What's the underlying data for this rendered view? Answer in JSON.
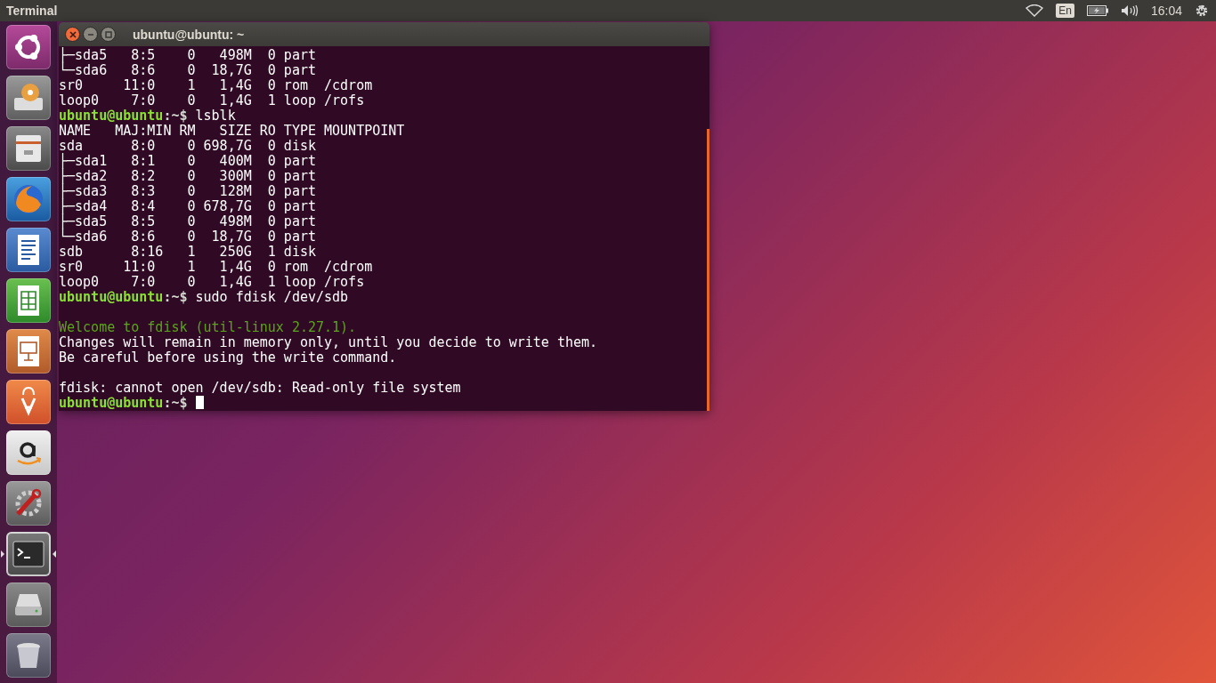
{
  "top_bar": {
    "title": "Terminal",
    "keyboard_layout": "En",
    "clock": "16:04"
  },
  "launcher": [
    {
      "kind": "dash",
      "selected": false
    },
    {
      "kind": "installer",
      "selected": false
    },
    {
      "kind": "files",
      "selected": false
    },
    {
      "kind": "browser",
      "selected": false
    },
    {
      "kind": "writer",
      "selected": false
    },
    {
      "kind": "calc",
      "selected": false
    },
    {
      "kind": "impress",
      "selected": false
    },
    {
      "kind": "store",
      "selected": false
    },
    {
      "kind": "amazon",
      "selected": false
    },
    {
      "kind": "settings",
      "selected": false
    },
    {
      "kind": "terminal",
      "selected": true
    },
    {
      "kind": "drive",
      "selected": false
    },
    {
      "kind": "trash",
      "selected": false
    }
  ],
  "window": {
    "title": "ubuntu@ubuntu: ~",
    "lines": [
      {
        "kind": "output",
        "text": "├─sda5   8:5    0   498M  0 part"
      },
      {
        "kind": "output",
        "text": "└─sda6   8:6    0  18,7G  0 part"
      },
      {
        "kind": "output",
        "text": "sr0     11:0    1   1,4G  0 rom  /cdrom"
      },
      {
        "kind": "output",
        "text": "loop0    7:0    0   1,4G  1 loop /rofs"
      },
      {
        "kind": "prompt",
        "user": "ubuntu@ubuntu",
        "path": ":~$",
        "command": "lsblk",
        "cursor": false
      },
      {
        "kind": "output",
        "text": "NAME   MAJ:MIN RM   SIZE RO TYPE MOUNTPOINT"
      },
      {
        "kind": "output",
        "text": "sda      8:0    0 698,7G  0 disk"
      },
      {
        "kind": "output",
        "text": "├─sda1   8:1    0   400M  0 part"
      },
      {
        "kind": "output",
        "text": "├─sda2   8:2    0   300M  0 part"
      },
      {
        "kind": "output",
        "text": "├─sda3   8:3    0   128M  0 part"
      },
      {
        "kind": "output",
        "text": "├─sda4   8:4    0 678,7G  0 part"
      },
      {
        "kind": "output",
        "text": "├─sda5   8:5    0   498M  0 part"
      },
      {
        "kind": "output",
        "text": "└─sda6   8:6    0  18,7G  0 part"
      },
      {
        "kind": "output",
        "text": "sdb      8:16   1   250G  1 disk"
      },
      {
        "kind": "output",
        "text": "sr0     11:0    1   1,4G  0 rom  /cdrom"
      },
      {
        "kind": "output",
        "text": "loop0    7:0    0   1,4G  1 loop /rofs"
      },
      {
        "kind": "prompt",
        "user": "ubuntu@ubuntu",
        "path": ":~$",
        "command": "sudo fdisk /dev/sdb",
        "cursor": false
      },
      {
        "kind": "blank"
      },
      {
        "kind": "welcome",
        "text": "Welcome to fdisk (util-linux 2.27.1)."
      },
      {
        "kind": "output",
        "text": "Changes will remain in memory only, until you decide to write them."
      },
      {
        "kind": "output",
        "text": "Be careful before using the write command."
      },
      {
        "kind": "blank"
      },
      {
        "kind": "output",
        "text": "fdisk: cannot open /dev/sdb: Read-only file system"
      },
      {
        "kind": "prompt",
        "user": "ubuntu@ubuntu",
        "path": ":~$",
        "cursor": true
      }
    ]
  }
}
